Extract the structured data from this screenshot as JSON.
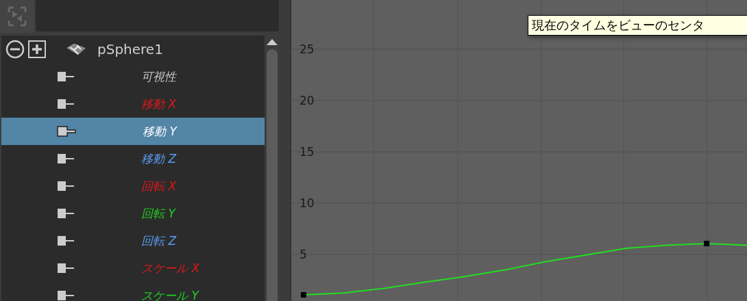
{
  "outliner": {
    "object": {
      "label": "pSphere1",
      "channels": [
        {
          "label": "可視性",
          "color": "#c8c8c8",
          "selected": false
        },
        {
          "label": "移動 X",
          "color": "#e01818",
          "selected": false
        },
        {
          "label": "移動 Y",
          "color": "#ffffff",
          "selected": true
        },
        {
          "label": "移動 Z",
          "color": "#5b9cf0",
          "selected": false
        },
        {
          "label": "回転 X",
          "color": "#e01818",
          "selected": false
        },
        {
          "label": "回転 Y",
          "color": "#1fd21f",
          "selected": false
        },
        {
          "label": "回転 Z",
          "color": "#5b9cf0",
          "selected": false
        },
        {
          "label": "スケール X",
          "color": "#e01818",
          "selected": false
        },
        {
          "label": "スケール Y",
          "color": "#1fd21f",
          "selected": false
        }
      ]
    }
  },
  "graph": {
    "tooltip": "現在のタイムをビューのセンタ",
    "chart_data": {
      "type": "line",
      "grid": true,
      "categories": [
        null,
        null,
        null,
        null,
        null,
        null,
        null,
        null,
        null,
        null,
        null,
        null
      ],
      "ylim": [
        0.47,
        29.8
      ],
      "yticks": [
        5,
        10,
        15,
        20,
        25
      ],
      "series": [
        {
          "color": "#22dd22",
          "values": [
            1.07,
            1.25,
            1.7,
            2.3,
            2.85,
            3.5,
            4.3,
            4.95,
            5.6,
            5.9,
            6.07,
            5.9
          ]
        }
      ]
    }
  }
}
